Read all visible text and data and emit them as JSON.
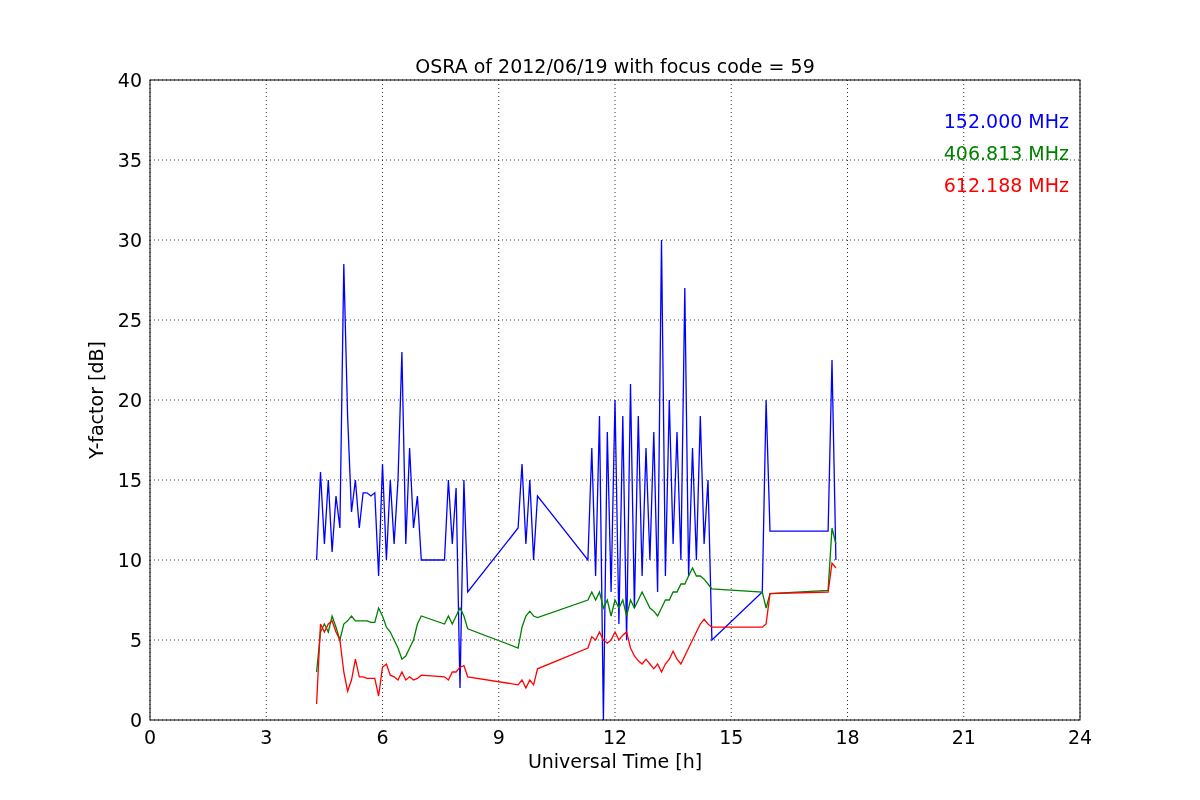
{
  "chart_data": {
    "type": "line",
    "title": "OSRA of 2012/06/19 with focus code = 59",
    "xlabel": "Universal Time [h]",
    "ylabel": "Y-factor [dB]",
    "xlim": [
      0,
      24
    ],
    "ylim": [
      0,
      40
    ],
    "xticks": [
      0,
      3,
      6,
      9,
      12,
      15,
      18,
      21,
      24
    ],
    "yticks": [
      0,
      5,
      10,
      15,
      20,
      25,
      30,
      35,
      40
    ],
    "grid": true,
    "x": [
      4.3,
      4.4,
      4.5,
      4.6,
      4.7,
      4.8,
      4.9,
      5.0,
      5.1,
      5.2,
      5.3,
      5.4,
      5.5,
      5.6,
      5.7,
      5.8,
      5.9,
      6.0,
      6.1,
      6.2,
      6.3,
      6.4,
      6.5,
      6.6,
      6.7,
      6.8,
      6.9,
      7.0,
      7.6,
      7.7,
      7.8,
      7.9,
      8.0,
      8.1,
      8.2,
      9.5,
      9.6,
      9.7,
      9.8,
      9.9,
      10.0,
      11.3,
      11.4,
      11.5,
      11.6,
      11.7,
      11.8,
      11.9,
      12.0,
      12.1,
      12.2,
      12.3,
      12.4,
      12.5,
      12.6,
      12.7,
      12.8,
      12.9,
      13.0,
      13.1,
      13.2,
      13.3,
      13.4,
      13.5,
      13.6,
      13.7,
      13.8,
      13.9,
      14.0,
      14.1,
      14.2,
      14.3,
      14.4,
      14.5,
      15.8,
      15.9,
      16.0,
      17.5,
      17.6,
      17.7
    ],
    "series": [
      {
        "name": "152.000 MHz",
        "color": "#0000ff",
        "values": [
          10,
          15.5,
          11,
          15,
          10.5,
          14,
          12,
          28.5,
          19,
          13,
          15,
          12,
          14.2,
          14.2,
          14,
          14.2,
          9,
          16,
          10,
          15,
          11,
          15,
          23,
          11,
          17,
          12,
          14,
          10,
          10,
          15,
          11,
          14.5,
          2,
          15,
          8,
          12,
          16,
          11,
          15,
          10,
          14,
          10,
          17,
          9,
          19,
          0,
          18,
          8,
          20,
          6,
          19,
          5,
          21,
          7,
          19,
          9,
          17,
          10,
          18,
          8,
          30,
          9,
          20,
          11,
          18,
          10,
          27,
          9,
          17,
          10,
          19,
          11,
          15,
          5,
          8,
          20,
          11.8,
          11.8,
          22.5,
          10
        ]
      },
      {
        "name": "406.813 MHz",
        "color": "#008000",
        "values": [
          3,
          5.5,
          6,
          5.5,
          6.5,
          5.8,
          5,
          6,
          6.2,
          6.5,
          6.2,
          6.2,
          6.2,
          6.2,
          6.1,
          6.1,
          7,
          6.5,
          5.8,
          5.5,
          5,
          4.5,
          3.8,
          4,
          4.5,
          5,
          6,
          6.5,
          6,
          6.5,
          6,
          6.5,
          7,
          6.5,
          5.7,
          4.5,
          5.8,
          6.5,
          6.8,
          6.5,
          6.4,
          7.5,
          8,
          7.5,
          8,
          7,
          7.5,
          6.5,
          7.5,
          7,
          7.5,
          6.5,
          7.5,
          7,
          7.5,
          8,
          7.5,
          7,
          6.8,
          6.5,
          7,
          7.5,
          7.5,
          8,
          8,
          8.5,
          8.5,
          9,
          9.5,
          9,
          9,
          8.8,
          8.5,
          8.2,
          8,
          7,
          7.9,
          8.1,
          12,
          11
        ]
      },
      {
        "name": "612.188 MHz",
        "color": "#ff0000",
        "values": [
          1,
          6,
          5.5,
          6,
          6.2,
          5.5,
          5,
          3,
          1.8,
          2.5,
          3.8,
          2.7,
          2.7,
          2.6,
          2.6,
          2.6,
          1.5,
          3.3,
          3.5,
          2.8,
          2.7,
          2.5,
          3,
          2.5,
          2.7,
          2.5,
          2.6,
          2.8,
          2.7,
          2.5,
          3,
          3,
          3.3,
          3.4,
          2.7,
          2.2,
          2.5,
          2,
          2.5,
          2.2,
          3.2,
          4.5,
          5.2,
          5,
          5.5,
          5,
          4.8,
          5,
          5.5,
          5,
          5.3,
          5.5,
          4.5,
          4,
          3.7,
          3.5,
          3.8,
          3.5,
          3.2,
          3.5,
          3,
          3.5,
          3.8,
          4.3,
          3.8,
          3.5,
          4,
          4.5,
          5,
          5.5,
          6,
          6.3,
          6,
          5.8,
          5.8,
          6,
          7.9,
          8.0,
          9.8,
          9.5
        ]
      }
    ]
  }
}
